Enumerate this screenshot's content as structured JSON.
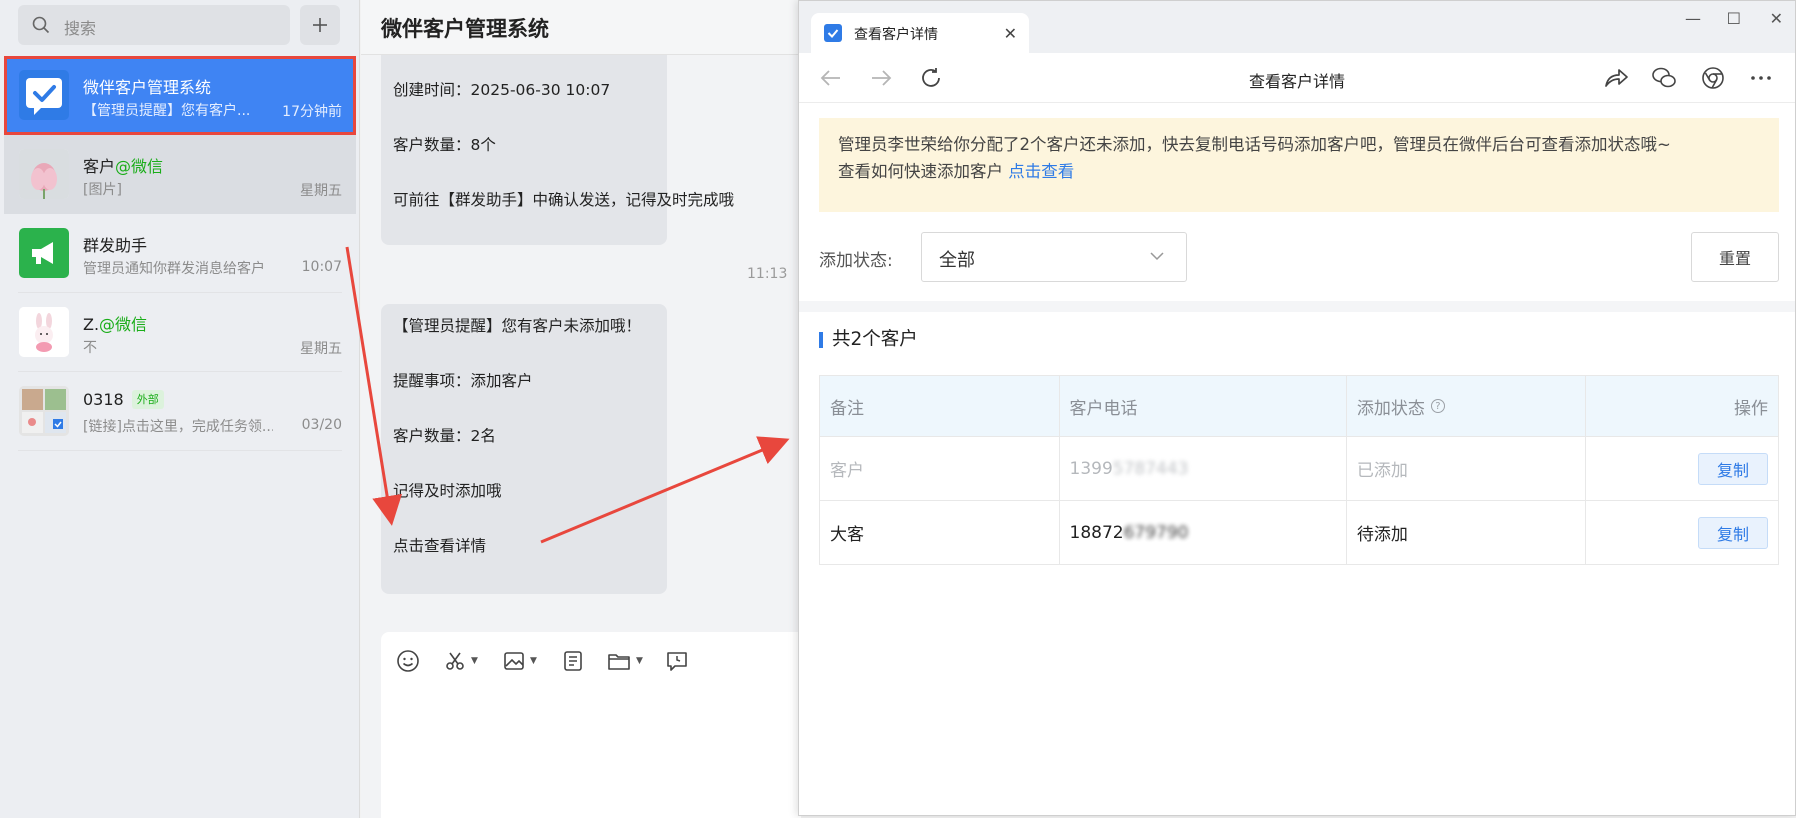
{
  "sidebar": {
    "search_placeholder": "搜索",
    "add_label": "+",
    "chats": [
      {
        "name": "微伴客户管理系统",
        "name_suffix": "",
        "preview": "【管理员提醒】您有客户...",
        "time": "17分钟前"
      },
      {
        "name": "客户",
        "name_suffix": "@微信",
        "preview": "[图片]",
        "time": "星期五"
      },
      {
        "name": "群发助手",
        "name_suffix": "",
        "preview": "管理员通知你群发消息给客户",
        "time": "10:07"
      },
      {
        "name": "Z.",
        "name_suffix": "@微信",
        "preview": "不",
        "time": "星期五"
      },
      {
        "name": "0318",
        "name_suffix": "",
        "tag": "外部",
        "preview": "[链接]点击这里，完成任务领...",
        "time": "03/20"
      }
    ]
  },
  "chat": {
    "title": "微伴客户管理系统",
    "msg1": {
      "line1": "创建时间：2025-06-30 10:07",
      "line2": "客户数量：8个",
      "line3": "可前往【群发助手】中确认发送，记得及时完成哦"
    },
    "time": "11:13",
    "msg2": {
      "line1": "【管理员提醒】您有客户未添加哦！",
      "line2": "提醒事项：添加客户",
      "line3": "客户数量：2名",
      "line4": "记得及时添加哦",
      "link": "点击查看详情"
    },
    "tools": [
      "emoji-icon",
      "scissors-icon",
      "image-icon",
      "document-icon",
      "folder-icon",
      "schedule-icon"
    ]
  },
  "browser": {
    "tab_title": "查看客户详情",
    "page_title": "查看客户详情",
    "win_controls": {
      "minimize": "—",
      "maximize": "☐",
      "close": "✕"
    },
    "notice": {
      "text1": "管理员李世荣给你分配了2个客户还未添加，快去复制电话号码添加客户吧，管理员在微伴后台可查看添加状态哦~",
      "text2": "查看如何快速添加客户",
      "link": "点击查看"
    },
    "filter": {
      "label": "添加状态:",
      "value": "全部",
      "reset": "重置"
    },
    "count_title": "共2个客户",
    "table": {
      "headers": [
        "备注",
        "客户电话",
        "添加状态",
        "操作"
      ],
      "rows": [
        {
          "note": "客户",
          "phone_visible": "1399",
          "phone_blur": "5787443",
          "status": "已添加",
          "action": "复制"
        },
        {
          "note": "大客",
          "phone_visible": "18872",
          "phone_blur": "679790",
          "status": "待添加",
          "action": "复制"
        }
      ]
    }
  },
  "colors": {
    "accent": "#3f84f3",
    "link": "#2f7be6",
    "annotation": "#e8473d",
    "notice_bg": "#fdf5dd",
    "wechat_green": "#1aad19"
  }
}
